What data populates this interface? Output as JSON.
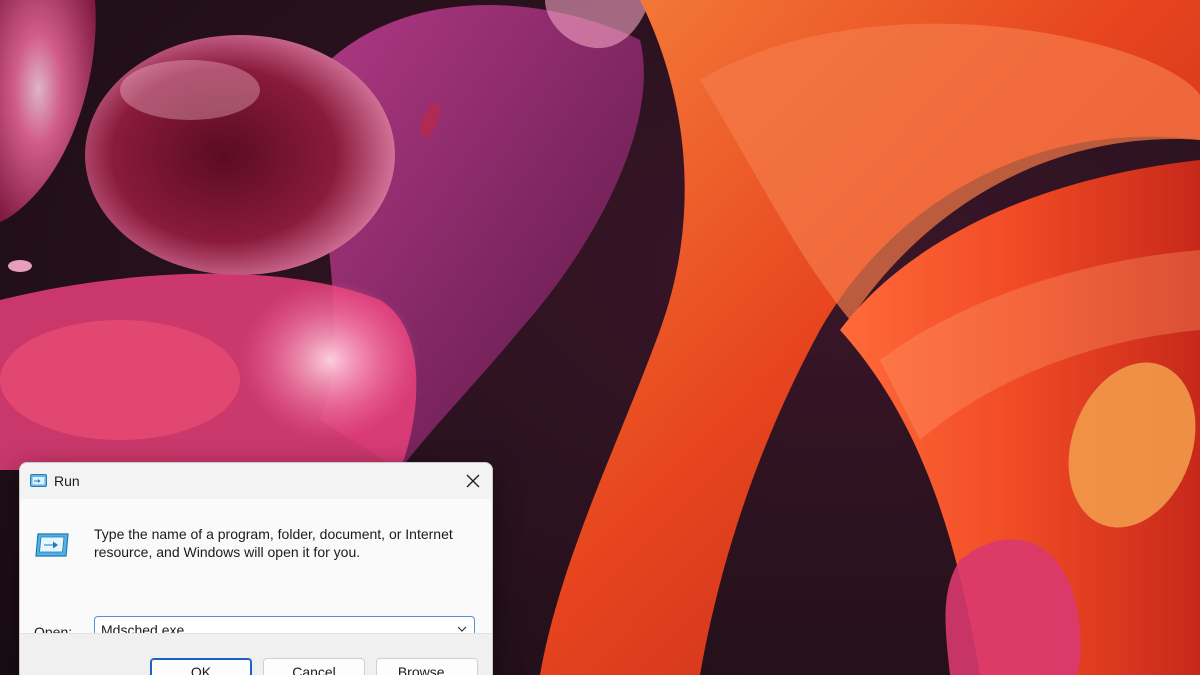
{
  "run_dialog": {
    "title": "Run",
    "description": "Type the name of a program, folder, document, or Internet resource, and Windows will open it for you.",
    "open_label": "Open:",
    "input_value": "Mdsched.exe",
    "buttons": {
      "ok": "OK",
      "cancel": "Cancel",
      "browse": "Browse..."
    },
    "icons": {
      "title": "run-app-icon",
      "body": "run-program-icon",
      "close": "close-icon",
      "dropdown": "chevron-down-icon"
    }
  },
  "colors": {
    "accent": "#1a63c4",
    "dialog_bg": "#f3f3f3",
    "wallpaper_orange": "#e2431f",
    "wallpaper_pink": "#d9386f"
  }
}
